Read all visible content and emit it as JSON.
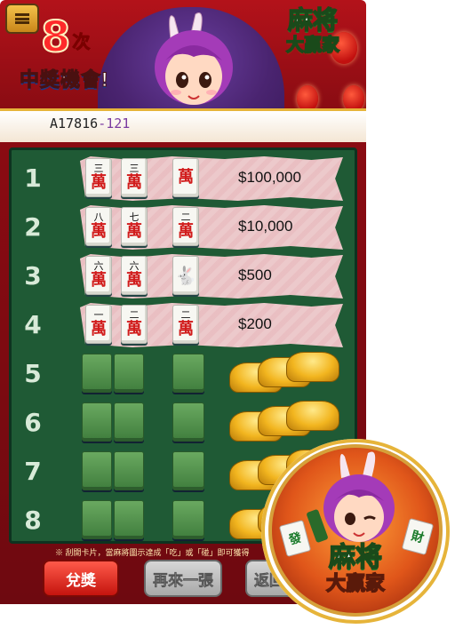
{
  "header": {
    "times_number": "8",
    "times_unit": "次",
    "chance_label": "中獎機會!",
    "serial_prefix": "A17816",
    "serial_sep": "-",
    "serial_suffix": "121",
    "logo_top": "麻将",
    "logo_bottom": "大贏家"
  },
  "rows": [
    {
      "num": "1",
      "tiles": [
        {
          "n": "三",
          "w": "萬"
        },
        {
          "n": "三",
          "w": "萬"
        },
        {
          "n": "",
          "w": "萬"
        }
      ],
      "prize": "$100,000",
      "revealed": true
    },
    {
      "num": "2",
      "tiles": [
        {
          "n": "八",
          "w": "萬"
        },
        {
          "n": "七",
          "w": "萬"
        },
        {
          "n": "二",
          "w": "萬"
        }
      ],
      "prize": "$10,000",
      "revealed": true
    },
    {
      "num": "3",
      "tiles": [
        {
          "n": "六",
          "w": "萬"
        },
        {
          "n": "六",
          "w": "萬"
        },
        {
          "n": "",
          "w": "🐇"
        }
      ],
      "prize": "$500",
      "revealed": true
    },
    {
      "num": "4",
      "tiles": [
        {
          "n": "一",
          "w": "萬"
        },
        {
          "n": "二",
          "w": "萬"
        },
        {
          "n": "二",
          "w": "萬"
        }
      ],
      "prize": "$200",
      "revealed": true
    },
    {
      "num": "5",
      "revealed": false
    },
    {
      "num": "6",
      "revealed": false
    },
    {
      "num": "7",
      "revealed": false
    },
    {
      "num": "8",
      "revealed": false
    }
  ],
  "note": "※ 刮開卡片，當麻將圖示達成「吃」或「碰」即可獲得",
  "buttons": {
    "redeem": "兌獎",
    "again": "再來一張",
    "back": "返回"
  },
  "badge": {
    "logo_top": "麻将",
    "logo_bottom": "大贏家",
    "tile_left": "發",
    "tile_right": "財"
  },
  "colors": {
    "frame_red": "#8a0b12",
    "board_green": "#1f5a35",
    "redeem_red": "#c4140e",
    "gold": "#f2b51f"
  }
}
